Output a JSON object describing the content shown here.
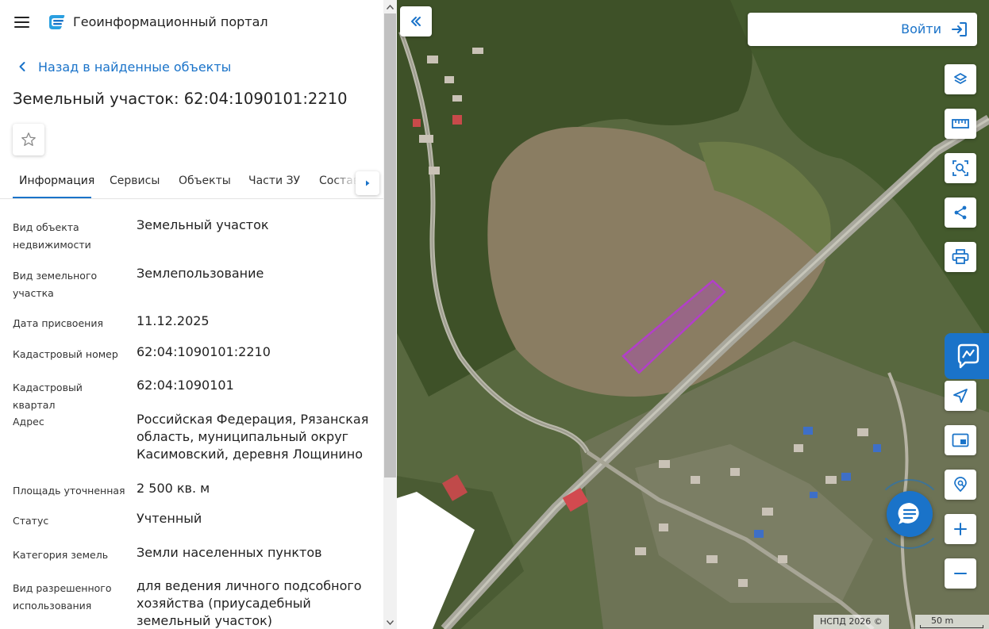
{
  "header": {
    "title": "Геоинформационный портал"
  },
  "nav": {
    "back_label": "Назад в найденные объекты"
  },
  "page": {
    "title": "Земельный участок: 62:04:1090101:2210"
  },
  "tabs": [
    {
      "label": "Информация"
    },
    {
      "label": "Сервисы"
    },
    {
      "label": "Объекты"
    },
    {
      "label": "Части ЗУ"
    },
    {
      "label": "Состав"
    }
  ],
  "info": [
    {
      "label": "Вид объекта недвижимости",
      "value": "Земельный участок"
    },
    {
      "label": "Вид земельного участка",
      "value": "Землепользование"
    },
    {
      "label": "Дата присвоения",
      "value": "11.12.2025"
    },
    {
      "label": "Кадастровый номер",
      "value": "62:04:1090101:2210"
    },
    {
      "label": "Кадастровый квартал",
      "value": "62:04:1090101"
    },
    {
      "label": "Адрес",
      "value": "Российская Федерация, Рязанская область, муниципальный округ Касимовский, деревня Лощинино"
    },
    {
      "label": "Площадь уточненная",
      "value": "2 500 кв. м"
    },
    {
      "label": "Статус",
      "value": "Учтенный"
    },
    {
      "label": "Категория земель",
      "value": "Земли населенных пунктов"
    },
    {
      "label": "Вид разрешенного использования",
      "value": "для ведения личного подсобного хозяйства (приусадебный земельный участок)"
    }
  ],
  "map": {
    "login_label": "Войти",
    "copyright": "НСПД 2026 ©",
    "scale_label": "50 m",
    "tools": [
      {
        "icon": "layers-icon"
      },
      {
        "icon": "ruler-icon"
      },
      {
        "icon": "area-select-icon"
      },
      {
        "icon": "share-icon"
      },
      {
        "icon": "print-icon"
      },
      {
        "icon": "navigate-icon"
      },
      {
        "icon": "minimap-icon"
      },
      {
        "icon": "location-search-icon"
      },
      {
        "icon": "zoom-in-icon"
      },
      {
        "icon": "zoom-out-icon"
      }
    ]
  },
  "colors": {
    "accent": "#1a73c9",
    "parcel": "#b23fc9"
  }
}
